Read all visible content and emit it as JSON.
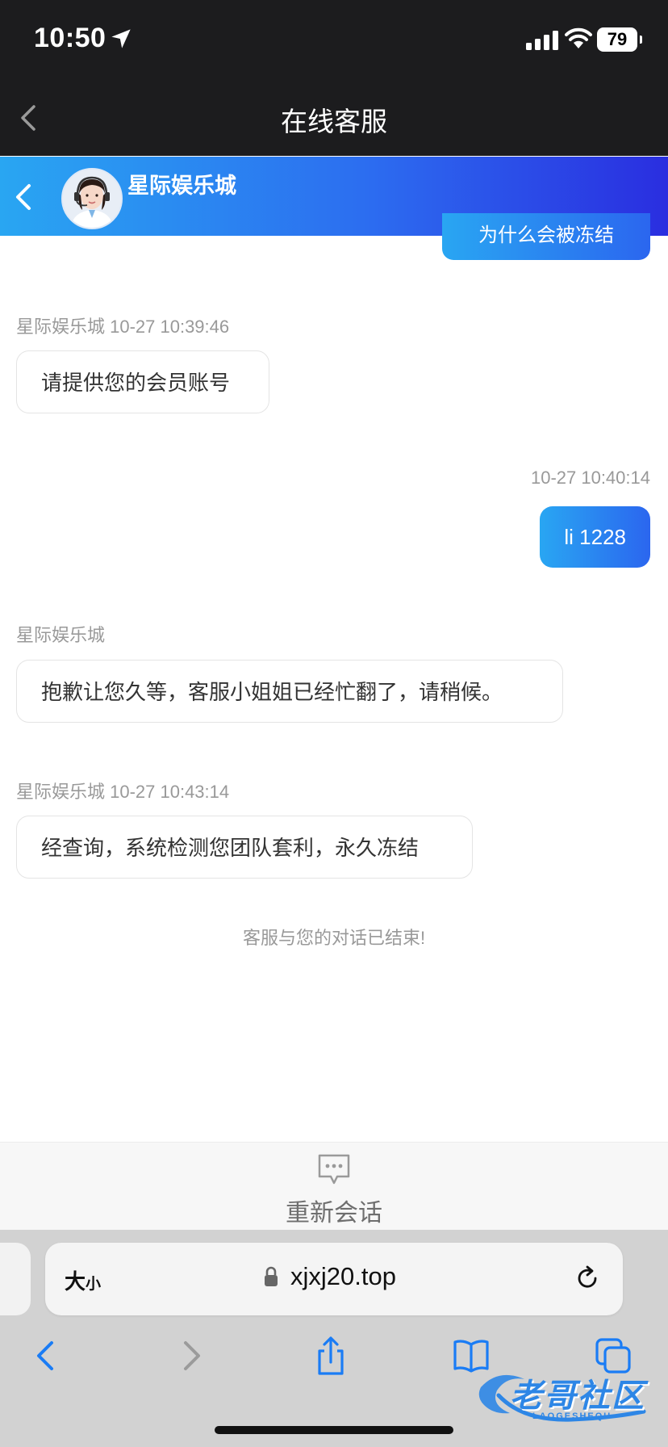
{
  "status_bar": {
    "time": "10:50",
    "battery": "79"
  },
  "page": {
    "title": "在线客服"
  },
  "chat_header": {
    "name": "星际娱乐城"
  },
  "messages": {
    "partial_outgoing": "为什么会被冻结",
    "m1": {
      "meta": "星际娱乐城 10-27 10:39:46",
      "text": "请提供您的会员账号"
    },
    "m2": {
      "meta": "10-27 10:40:14",
      "text": "li 1228"
    },
    "m3": {
      "meta": "星际娱乐城",
      "text": "抱歉让您久等，客服小姐姐已经忙翻了，请稍候。"
    },
    "m4": {
      "meta": "星际娱乐城 10-27 10:43:14",
      "text": "经查询，系统检测您团队套利，永久冻结"
    },
    "end_note": "客服与您的对话已结束!"
  },
  "restart": {
    "label": "重新会话"
  },
  "safari": {
    "size_big": "大",
    "size_small": "小",
    "url": "xjxj20.top"
  },
  "watermark": {
    "text": "老哥社区",
    "sub": "LAOGESHEQU"
  },
  "colors": {
    "accent_start": "#29a6f2",
    "accent_end": "#2a2ee0",
    "safari_blue": "#1a7cf5"
  }
}
